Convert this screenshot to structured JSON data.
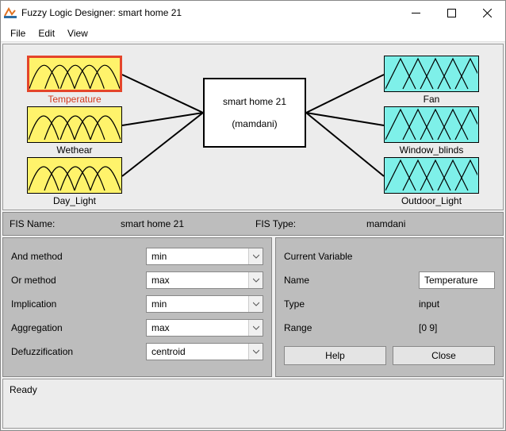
{
  "window": {
    "title": "Fuzzy Logic Designer: smart home 21"
  },
  "menu": {
    "file": "File",
    "edit": "Edit",
    "view": "View"
  },
  "diagram": {
    "inputs": [
      {
        "label": "Temperature",
        "selected": true
      },
      {
        "label": "Wethear",
        "selected": false
      },
      {
        "label": "Day_Light",
        "selected": false
      }
    ],
    "outputs": [
      {
        "label": "Fan"
      },
      {
        "label": "Window_blinds"
      },
      {
        "label": "Outdoor_Light"
      }
    ],
    "center": {
      "name": "smart home 21",
      "type": "(mamdani)"
    }
  },
  "fis": {
    "name_label": "FIS Name:",
    "name_value": "smart home 21",
    "type_label": "FIS Type:",
    "type_value": "mamdani"
  },
  "methods": {
    "and_label": "And method",
    "and": "min",
    "or_label": "Or method",
    "or": "max",
    "imp_label": "Implication",
    "imp": "min",
    "agg_label": "Aggregation",
    "agg": "max",
    "def_label": "Defuzzification",
    "def": "centroid"
  },
  "current": {
    "heading": "Current Variable",
    "name_label": "Name",
    "name": "Temperature",
    "type_label": "Type",
    "type": "input",
    "range_label": "Range",
    "range": "[0 9]"
  },
  "buttons": {
    "help": "Help",
    "close": "Close"
  },
  "status": "Ready"
}
